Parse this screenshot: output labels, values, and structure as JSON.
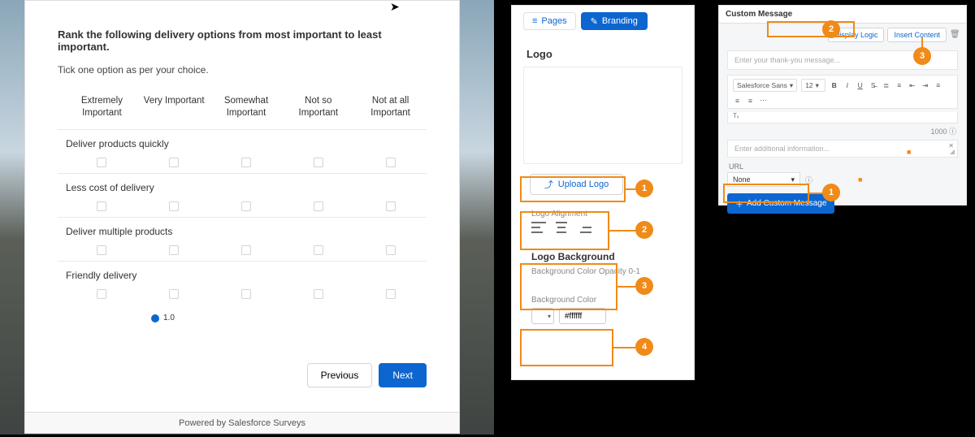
{
  "survey": {
    "question": "Rank the following delivery options from most important to least important.",
    "instruction": "Tick one option as per your choice.",
    "scale": [
      "Extremely Important",
      "Very Important",
      "Somewhat Important",
      "Not so Important",
      "Not at all Important"
    ],
    "rows": [
      "Deliver products quickly",
      "Less cost of delivery",
      "Deliver multiple products",
      "Friendly delivery"
    ],
    "previous": "Previous",
    "next": "Next",
    "powered_by": "Powered by Salesforce Surveys"
  },
  "branding": {
    "tabs": {
      "pages": "Pages",
      "branding": "Branding"
    },
    "logo_heading": "Logo",
    "upload_logo": "Upload Logo",
    "logo_alignment_label": "Logo Alignment",
    "logo_background_title": "Logo Background",
    "opacity_label": "Background Color Opacity 0-1",
    "opacity_value": "1.0",
    "background_color_label": "Background Color",
    "background_color_hex": "#ffffff",
    "callouts": {
      "c1": "1",
      "c2": "2",
      "c3": "3",
      "c4": "4"
    }
  },
  "custom_message": {
    "header": "Custom Message",
    "display_logic": "Display Logic",
    "insert_content": "Insert Content",
    "thank_placeholder": "Enter your thank-you message...",
    "font_name": "Salesforce Sans",
    "font_size": "12",
    "counter": "1000",
    "additional_placeholder": "Enter additional information...",
    "url_label": "URL",
    "url_value": "None",
    "add_button": "Add Custom Message",
    "callouts": {
      "c1": "1",
      "c2": "2",
      "c3": "3"
    }
  }
}
